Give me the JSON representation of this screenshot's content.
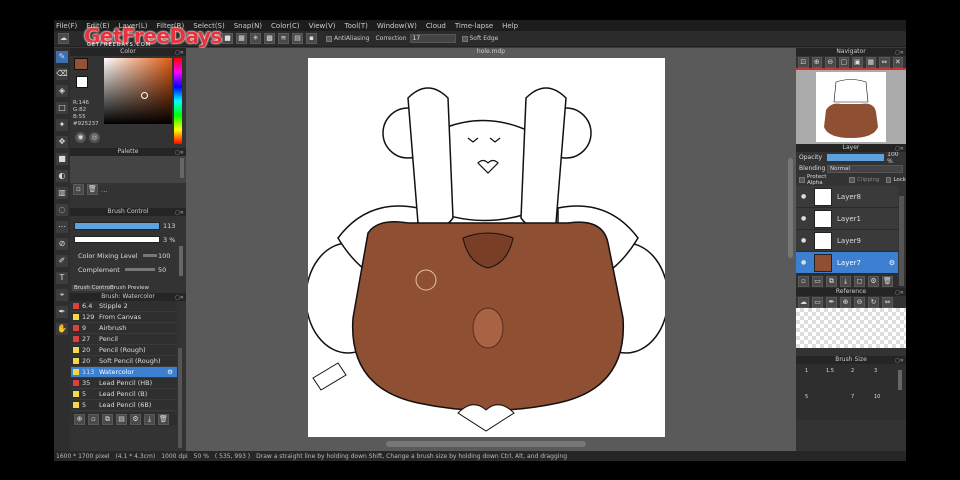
{
  "menu": [
    "File(F)",
    "Edit(E)",
    "Layer(L)",
    "Filter(R)",
    "Select(S)",
    "Snap(N)",
    "Color(C)",
    "View(V)",
    "Tool(T)",
    "Window(W)",
    "Cloud",
    "Time-lapse",
    "Help"
  ],
  "watermark": {
    "brand": "GetFreeDays",
    "sub": "GETFREEDAYS.COM"
  },
  "toolbar": {
    "antialias_label": "AntiAliasing",
    "correction_label": "Correction",
    "correction_value": "17",
    "soft_edge_label": "Soft Edge"
  },
  "color_panel": {
    "title": "Color",
    "r": "R:146",
    "g": "G:82",
    "b": "B:55",
    "hex": "#925237",
    "accent": "#925237"
  },
  "palette_panel": {
    "title": "Palette",
    "more": "..."
  },
  "brush_control": {
    "title": "Brush Control",
    "size": "113",
    "opacity": "3 %",
    "mixing_label": "Color Mixing Level",
    "mixing_value": "100",
    "complement_label": "Complement",
    "complement_value": "50",
    "tab1": "Brush Control",
    "tab2": "Brush Preview"
  },
  "brush_list": {
    "title": "Brush: Watercolor",
    "items": [
      {
        "size": "6.4",
        "name": "Stipple 2",
        "color": "#d94040"
      },
      {
        "size": "129",
        "name": "From Canvas",
        "color": "#f2d84a"
      },
      {
        "size": "9",
        "name": "Airbrush",
        "color": "#d94040"
      },
      {
        "size": "27",
        "name": "Pencil",
        "color": "#d94040"
      },
      {
        "size": "20",
        "name": "Pencil (Rough)",
        "color": "#f2d84a"
      },
      {
        "size": "20",
        "name": "Soft Pencil (Rough)",
        "color": "#f2d84a"
      },
      {
        "size": "113",
        "name": "Watercolor",
        "color": "#f2d84a",
        "selected": true
      },
      {
        "size": "35",
        "name": "Lead Pencil (HB)",
        "color": "#d94040"
      },
      {
        "size": "5",
        "name": "Lead Pencil (B)",
        "color": "#f2d84a"
      },
      {
        "size": "5",
        "name": "Lead Pencil (6B)",
        "color": "#f2d84a"
      }
    ]
  },
  "document": {
    "title": "hole.mdp"
  },
  "navigator": {
    "title": "Navigator"
  },
  "layer_panel": {
    "title": "Layer",
    "opacity_label": "Opacity",
    "opacity_value": "100 %",
    "blending_label": "Blending",
    "blending_value": "Normal",
    "protect_alpha": "Protect Alpha",
    "clipping": "Clipping",
    "lock": "Lock",
    "layers": [
      {
        "name": "Layer8"
      },
      {
        "name": "Layer1"
      },
      {
        "name": "Layer9"
      },
      {
        "name": "Layer7",
        "selected": true
      }
    ]
  },
  "reference": {
    "title": "Reference"
  },
  "brush_size": {
    "title": "Brush Size",
    "labels": [
      "1",
      "1.5",
      "2",
      "3",
      "5",
      "7",
      "10"
    ]
  },
  "status": {
    "dims": "1600 * 1700 pixel",
    "size_cm": "(4.1 * 4.3cm)",
    "dpi": "1000 dpi",
    "zoom": "50 %",
    "coords": "( 535, 993 )",
    "hint": "Draw a straight line by holding down Shift, Change a brush size by holding down Ctrl, Alt, and dragging"
  }
}
